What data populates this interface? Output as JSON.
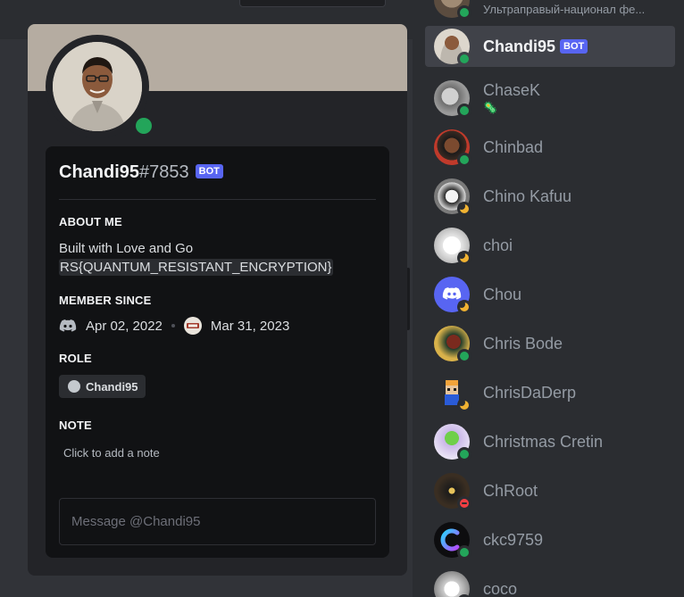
{
  "profile": {
    "username": "Chandi95",
    "discriminator": "#7853",
    "bot_badge": "BOT",
    "about_heading": "ABOUT ME",
    "about_line1": "Built with Love and Go",
    "about_line2": "RS{QUANTUM_RESISTANT_ENCRYPTION}",
    "member_since_heading": "MEMBER SINCE",
    "discord_since": "Apr 02, 2022",
    "server_since": "Mar 31, 2023",
    "role_heading": "ROLE",
    "role_name": "Chandi95",
    "note_heading": "NOTE",
    "note_placeholder": "Click to add a note",
    "message_placeholder": "Message @Chandi95",
    "status": "online"
  },
  "members": {
    "top_partial_subtitle": "Ультраправый-национал фе...",
    "items": [
      {
        "name": "Chandi95",
        "badge": "BOT",
        "status": "online",
        "selected": true
      },
      {
        "name": "ChaseK",
        "subtitle_emoji": "🦠",
        "status": "online"
      },
      {
        "name": "Chinbad",
        "status": "online"
      },
      {
        "name": "Chino Kafuu",
        "status": "idle"
      },
      {
        "name": "choi",
        "status": "idle"
      },
      {
        "name": "Chou",
        "status": "idle"
      },
      {
        "name": "Chris Bode",
        "status": "online"
      },
      {
        "name": "ChrisDaDerp",
        "status": "idle"
      },
      {
        "name": "Christmas Cretin",
        "status": "online"
      },
      {
        "name": "ChRoot",
        "status": "dnd"
      },
      {
        "name": "ckc9759",
        "status": "online"
      },
      {
        "name": "coco",
        "status": "online"
      }
    ]
  },
  "colors": {
    "online": "#23a55a",
    "idle": "#f0b232",
    "dnd": "#f23f43",
    "brand": "#5865f2"
  }
}
